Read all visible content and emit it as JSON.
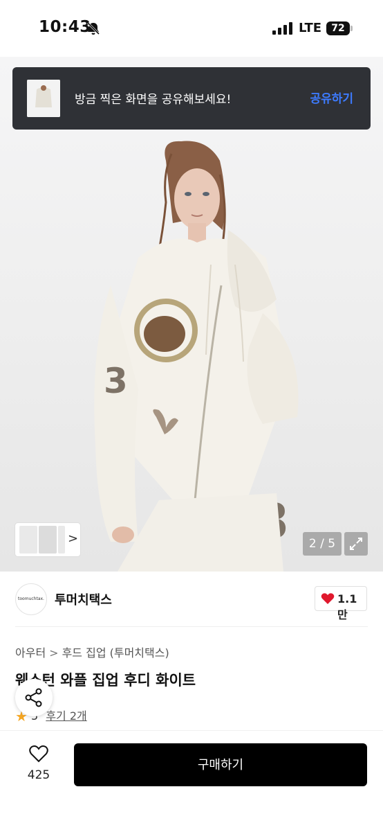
{
  "status_bar": {
    "time": "10:43",
    "network": "LTE",
    "battery": "72"
  },
  "toast": {
    "message": "방금 찍은 화면을 공유해보세요!",
    "action": "공유하기"
  },
  "gallery": {
    "counter": "2 / 5",
    "thumbnail_nav": ">"
  },
  "seller": {
    "logo_text": "toomuchtax.",
    "name": "투머치택스"
  },
  "likes": {
    "count": "1.1만"
  },
  "breadcrumb": {
    "category": "아우터",
    "separator": ">",
    "subcategory": "후드 집업 (투머치택스)"
  },
  "product": {
    "title": "웨스턴 와플 집업 후디 화이트"
  },
  "rating": {
    "score": "5",
    "reviews": "후기 2개"
  },
  "bottom_bar": {
    "wish_count": "425",
    "buy_label": "구매하기"
  },
  "colors": {
    "accent_blue": "#3d7bff",
    "toast_bg": "#2f3136",
    "heart_red": "#e0182d",
    "star": "#f5a623",
    "buy_bg": "#000000"
  },
  "icons": [
    "bell-slash-icon",
    "signal-icon",
    "battery-icon",
    "expand-icon",
    "chevron-right-icon",
    "heart-icon",
    "star-icon",
    "share-icon"
  ]
}
